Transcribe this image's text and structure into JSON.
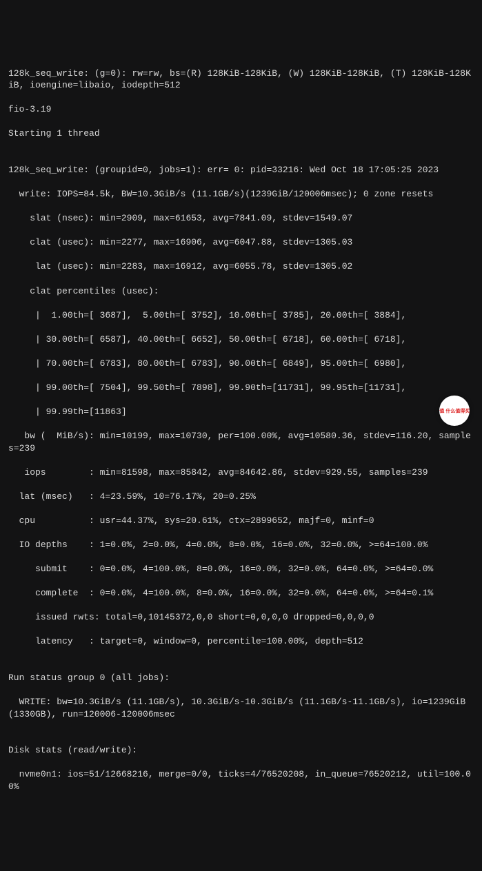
{
  "header": {
    "job_line": "128k_seq_write: (g=0): rw=rw, bs=(R) 128KiB-128KiB, (W) 128KiB-128KiB, (T) 128KiB-128KiB, ioengine=libaio, iodepth=512",
    "version": "fio-3.19",
    "starting": "Starting 1 thread"
  },
  "result": {
    "title": "128k_seq_write: (groupid=0, jobs=1): err= 0: pid=33216: Wed Oct 18 17:05:25 2023",
    "write_summary": "  write: IOPS=84.5k, BW=10.3GiB/s (11.1GB/s)(1239GiB/120006msec); 0 zone resets",
    "slat": "    slat (nsec): min=2909, max=61653, avg=7841.09, stdev=1549.07",
    "clat": "    clat (usec): min=2277, max=16906, avg=6047.88, stdev=1305.03",
    "lat": "     lat (usec): min=2283, max=16912, avg=6055.78, stdev=1305.02",
    "clat_pct_hdr": "    clat percentiles (usec):",
    "pct1": "     |  1.00th=[ 3687],  5.00th=[ 3752], 10.00th=[ 3785], 20.00th=[ 3884],",
    "pct2": "     | 30.00th=[ 6587], 40.00th=[ 6652], 50.00th=[ 6718], 60.00th=[ 6718],",
    "pct3": "     | 70.00th=[ 6783], 80.00th=[ 6783], 90.00th=[ 6849], 95.00th=[ 6980],",
    "pct4": "     | 99.00th=[ 7504], 99.50th=[ 7898], 99.90th=[11731], 99.95th=[11731],",
    "pct5": "     | 99.99th=[11863]",
    "bw": "   bw (  MiB/s): min=10199, max=10730, per=100.00%, avg=10580.36, stdev=116.20, samples=239",
    "iops": "   iops        : min=81598, max=85842, avg=84642.86, stdev=929.55, samples=239",
    "lat_msec": "  lat (msec)   : 4=23.59%, 10=76.17%, 20=0.25%",
    "cpu": "  cpu          : usr=44.37%, sys=20.61%, ctx=2899652, majf=0, minf=0",
    "io_depths": "  IO depths    : 1=0.0%, 2=0.0%, 4=0.0%, 8=0.0%, 16=0.0%, 32=0.0%, >=64=100.0%",
    "submit": "     submit    : 0=0.0%, 4=100.0%, 8=0.0%, 16=0.0%, 32=0.0%, 64=0.0%, >=64=0.0%",
    "complete": "     complete  : 0=0.0%, 4=100.0%, 8=0.0%, 16=0.0%, 32=0.0%, 64=0.0%, >=64=0.1%",
    "issued": "     issued rwts: total=0,10145372,0,0 short=0,0,0,0 dropped=0,0,0,0",
    "latency_t": "     latency   : target=0, window=0, percentile=100.00%, depth=512"
  },
  "group": {
    "hdr": "Run status group 0 (all jobs):",
    "write": "  WRITE: bw=10.3GiB/s (11.1GB/s), 10.3GiB/s-10.3GiB/s (11.1GB/s-11.1GB/s), io=1239GiB (1330GB), run=120006-120006msec"
  },
  "disk": {
    "hdr": "Disk stats (read/write):",
    "line": "  nvme0n1: ios=51/12668216, merge=0/0, ticks=4/76520208, in_queue=76520212, util=100.00%"
  },
  "badge_label": "值 什么值得买"
}
